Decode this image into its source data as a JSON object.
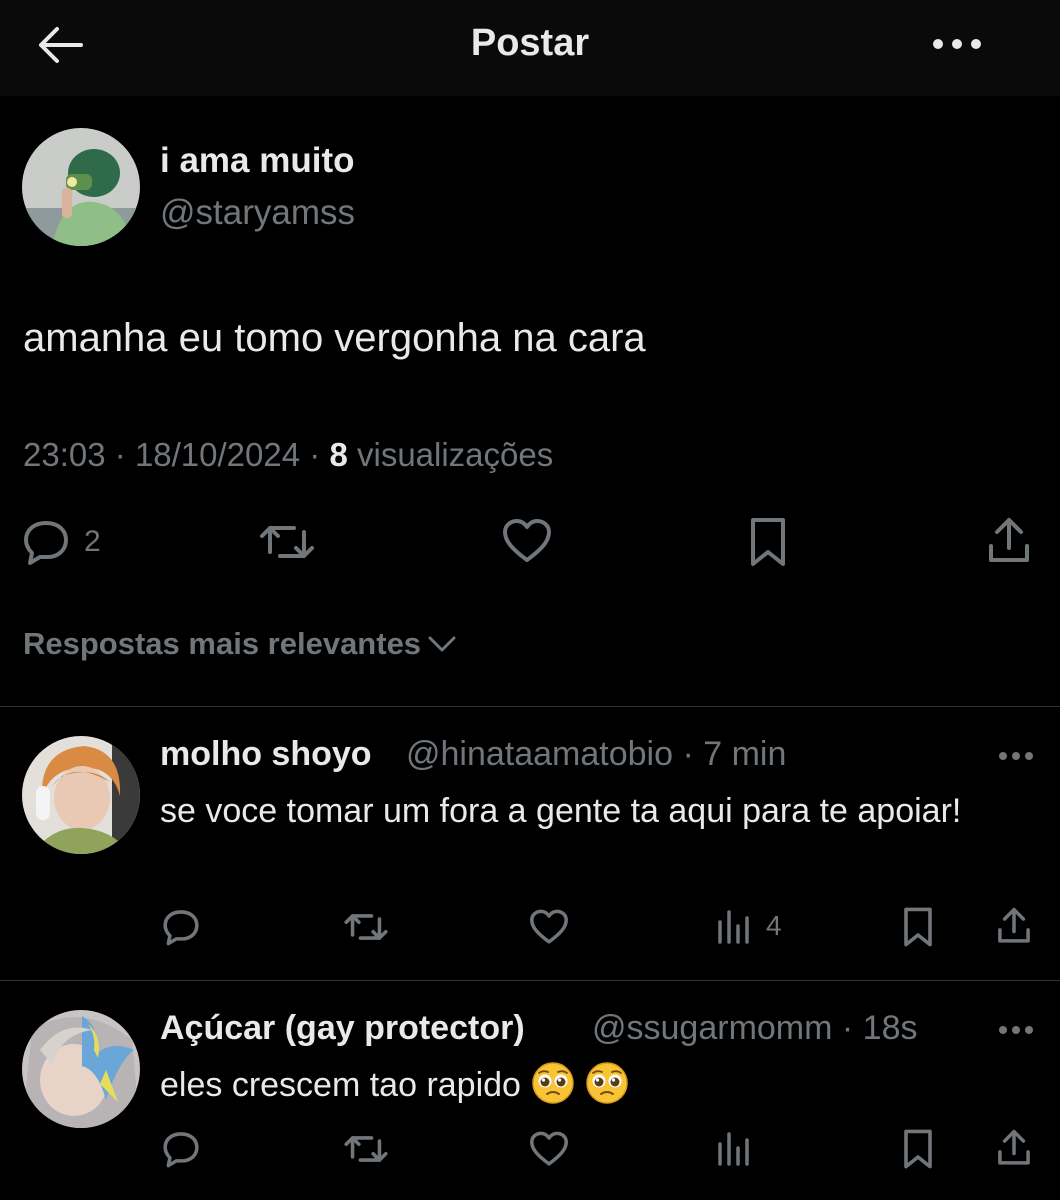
{
  "header": {
    "title": "Postar",
    "back_icon": "arrow-left-icon",
    "more_icon": "more-horizontal-icon"
  },
  "post": {
    "author_name": "i ama muito",
    "author_handle": "@staryamss",
    "text": "amanha eu tomo vergonha na cara",
    "time": "23:03",
    "date": "18/10/2024",
    "views_count": "8",
    "views_label": "visualizações",
    "reply_count": "2"
  },
  "replies_sort": {
    "label": "Respostas mais relevantes"
  },
  "replies": [
    {
      "name": "molho shoyo",
      "handle": "@hinataamatobio",
      "time": "7 min",
      "text": "se voce tomar um fora a gente ta aqui para te apoiar!",
      "views_count": "4"
    },
    {
      "name": "Açúcar (gay protector)",
      "handle": "@ssugarmomm",
      "time": "18s",
      "text": "eles crescem tao rapido",
      "emojis": [
        "pleading-face-emoji",
        "pleading-face-emoji"
      ]
    }
  ],
  "colors": {
    "background": "#000000",
    "header_background": "#0a0a0a",
    "text_primary": "#e7e9ea",
    "text_secondary": "#71767b",
    "divider": "#2f3336"
  }
}
